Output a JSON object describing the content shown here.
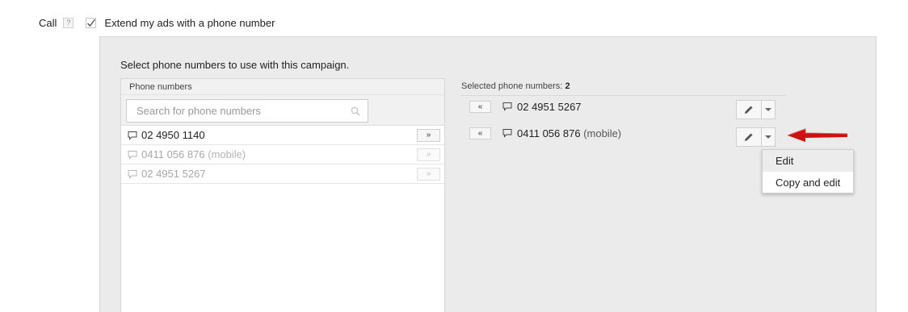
{
  "call": {
    "label": "Call",
    "help_icon": "?",
    "extend_checked": true,
    "extend_label": "Extend my ads with a phone number"
  },
  "panel": {
    "title": "Select phone numbers to use with this campaign."
  },
  "available": {
    "header": "Phone numbers",
    "search_placeholder": "Search for phone numbers",
    "add_symbol": "»",
    "items": [
      {
        "number": "02 4950 1140",
        "suffix": "",
        "enabled": true
      },
      {
        "number": "0411 056 876",
        "suffix": "(mobile)",
        "enabled": false
      },
      {
        "number": "02 4951 5267",
        "suffix": "",
        "enabled": false
      }
    ]
  },
  "selected": {
    "header_label": "Selected phone numbers:",
    "count": "2",
    "remove_symbol": "«",
    "items": [
      {
        "number": "02 4951 5267",
        "suffix": ""
      },
      {
        "number": "0411 056 876",
        "suffix": "(mobile)"
      }
    ]
  },
  "menu": {
    "items": [
      {
        "label": "Edit",
        "highlighted": true
      },
      {
        "label": "Copy and edit",
        "highlighted": false
      }
    ]
  },
  "colors": {
    "annotation_arrow": "#cc1111",
    "panel_bg": "#ebebeb"
  }
}
